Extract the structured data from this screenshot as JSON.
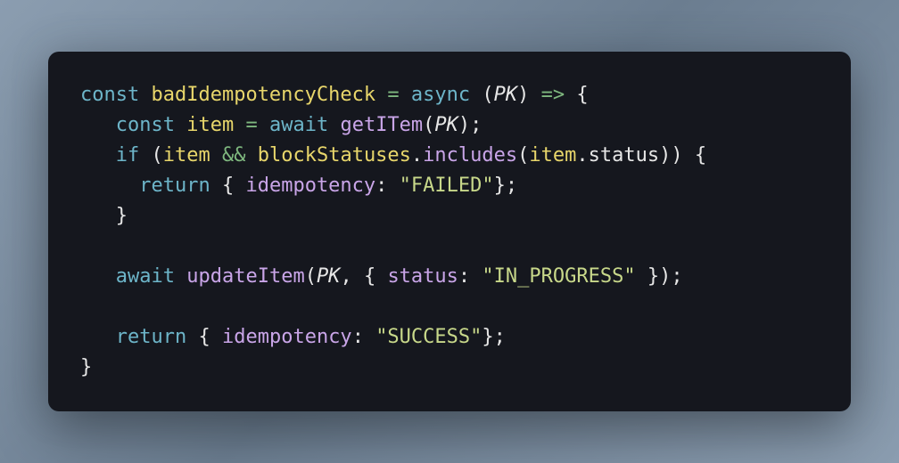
{
  "code": {
    "tokens": [
      [
        {
          "t": "const",
          "c": "keyword"
        },
        {
          "t": " ",
          "c": "ws"
        },
        {
          "t": "badIdempotencyCheck",
          "c": "ident"
        },
        {
          "t": " ",
          "c": "ws"
        },
        {
          "t": "=",
          "c": "op"
        },
        {
          "t": " ",
          "c": "ws"
        },
        {
          "t": "async",
          "c": "keyword"
        },
        {
          "t": " ",
          "c": "ws"
        },
        {
          "t": "(",
          "c": "paren"
        },
        {
          "t": "PK",
          "c": "param"
        },
        {
          "t": ")",
          "c": "paren"
        },
        {
          "t": " ",
          "c": "ws"
        },
        {
          "t": "=>",
          "c": "op"
        },
        {
          "t": " ",
          "c": "ws"
        },
        {
          "t": "{",
          "c": "brace"
        }
      ],
      [
        {
          "t": "   ",
          "c": "ws"
        },
        {
          "t": "const",
          "c": "keyword"
        },
        {
          "t": " ",
          "c": "ws"
        },
        {
          "t": "item",
          "c": "ident"
        },
        {
          "t": " ",
          "c": "ws"
        },
        {
          "t": "=",
          "c": "op"
        },
        {
          "t": " ",
          "c": "ws"
        },
        {
          "t": "await",
          "c": "keyword"
        },
        {
          "t": " ",
          "c": "ws"
        },
        {
          "t": "getITem",
          "c": "func"
        },
        {
          "t": "(",
          "c": "paren"
        },
        {
          "t": "PK",
          "c": "param"
        },
        {
          "t": ")",
          "c": "paren"
        },
        {
          "t": ";",
          "c": "punct"
        }
      ],
      [
        {
          "t": "   ",
          "c": "ws"
        },
        {
          "t": "if",
          "c": "keyword"
        },
        {
          "t": " ",
          "c": "ws"
        },
        {
          "t": "(",
          "c": "paren"
        },
        {
          "t": "item",
          "c": "ident"
        },
        {
          "t": " ",
          "c": "ws"
        },
        {
          "t": "&&",
          "c": "op"
        },
        {
          "t": " ",
          "c": "ws"
        },
        {
          "t": "blockStatuses",
          "c": "ident"
        },
        {
          "t": ".",
          "c": "punct"
        },
        {
          "t": "includes",
          "c": "func"
        },
        {
          "t": "(",
          "c": "paren"
        },
        {
          "t": "item",
          "c": "ident"
        },
        {
          "t": ".",
          "c": "punct"
        },
        {
          "t": "status",
          "c": "member"
        },
        {
          "t": ")",
          "c": "paren"
        },
        {
          "t": ")",
          "c": "paren"
        },
        {
          "t": " ",
          "c": "ws"
        },
        {
          "t": "{",
          "c": "brace"
        }
      ],
      [
        {
          "t": "     ",
          "c": "ws"
        },
        {
          "t": "return",
          "c": "keyword"
        },
        {
          "t": " ",
          "c": "ws"
        },
        {
          "t": "{",
          "c": "brace"
        },
        {
          "t": " ",
          "c": "ws"
        },
        {
          "t": "idempotency",
          "c": "func"
        },
        {
          "t": ":",
          "c": "punct"
        },
        {
          "t": " ",
          "c": "ws"
        },
        {
          "t": "\"FAILED\"",
          "c": "string"
        },
        {
          "t": "}",
          "c": "brace"
        },
        {
          "t": ";",
          "c": "punct"
        }
      ],
      [
        {
          "t": "   ",
          "c": "ws"
        },
        {
          "t": "}",
          "c": "brace"
        }
      ],
      [
        {
          "t": "",
          "c": "ws"
        }
      ],
      [
        {
          "t": "   ",
          "c": "ws"
        },
        {
          "t": "await",
          "c": "keyword"
        },
        {
          "t": " ",
          "c": "ws"
        },
        {
          "t": "updateItem",
          "c": "func"
        },
        {
          "t": "(",
          "c": "paren"
        },
        {
          "t": "PK",
          "c": "param"
        },
        {
          "t": ",",
          "c": "punct"
        },
        {
          "t": " ",
          "c": "ws"
        },
        {
          "t": "{",
          "c": "brace"
        },
        {
          "t": " ",
          "c": "ws"
        },
        {
          "t": "status",
          "c": "func"
        },
        {
          "t": ":",
          "c": "punct"
        },
        {
          "t": " ",
          "c": "ws"
        },
        {
          "t": "\"IN_PROGRESS\"",
          "c": "string"
        },
        {
          "t": " ",
          "c": "ws"
        },
        {
          "t": "}",
          "c": "brace"
        },
        {
          "t": ")",
          "c": "paren"
        },
        {
          "t": ";",
          "c": "punct"
        }
      ],
      [
        {
          "t": "",
          "c": "ws"
        }
      ],
      [
        {
          "t": "   ",
          "c": "ws"
        },
        {
          "t": "return",
          "c": "keyword"
        },
        {
          "t": " ",
          "c": "ws"
        },
        {
          "t": "{",
          "c": "brace"
        },
        {
          "t": " ",
          "c": "ws"
        },
        {
          "t": "idempotency",
          "c": "func"
        },
        {
          "t": ":",
          "c": "punct"
        },
        {
          "t": " ",
          "c": "ws"
        },
        {
          "t": "\"SUCCESS\"",
          "c": "string"
        },
        {
          "t": "}",
          "c": "brace"
        },
        {
          "t": ";",
          "c": "punct"
        }
      ],
      [
        {
          "t": "}",
          "c": "brace"
        }
      ]
    ]
  }
}
